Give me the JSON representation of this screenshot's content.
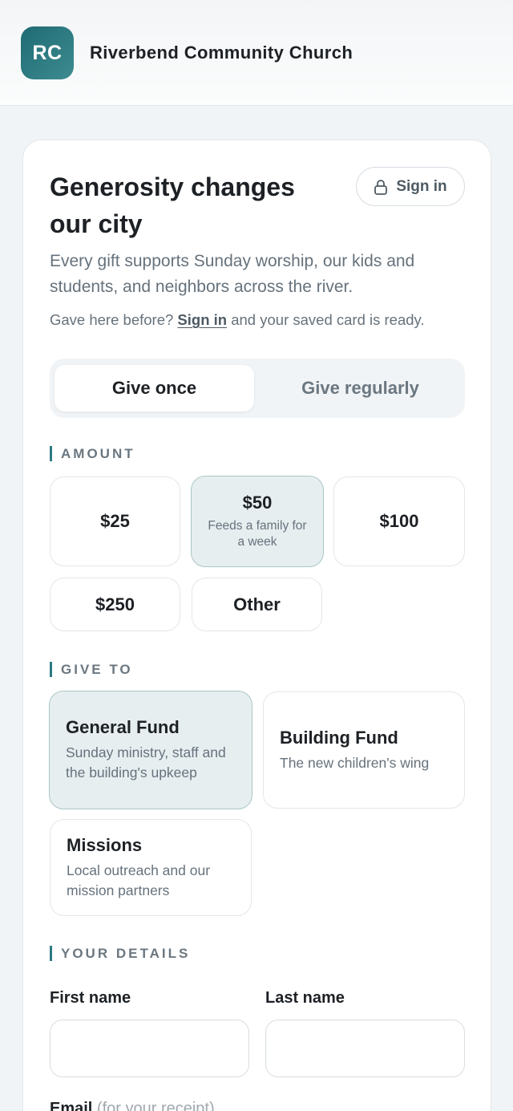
{
  "header": {
    "logo_initials": "RC",
    "church_name": "Riverbend Community Church"
  },
  "hero": {
    "headline": "Generosity changes our city",
    "signin_label": "Sign in",
    "intro": "Every gift supports Sunday worship, our kids and students, and neighbors across the river.",
    "return_prefix": "Gave here before?",
    "return_link": "Sign in",
    "return_suffix": "and your saved card is ready."
  },
  "frequency": {
    "options": [
      "Give once",
      "Give regularly"
    ],
    "selected": "Give once"
  },
  "amount": {
    "section_label": "AMOUNT",
    "options": [
      {
        "label": "$25",
        "note": ""
      },
      {
        "label": "$50",
        "note": "Feeds a family for a week"
      },
      {
        "label": "$100",
        "note": ""
      },
      {
        "label": "$250",
        "note": ""
      },
      {
        "label": "Other",
        "note": ""
      }
    ],
    "selected": "$50"
  },
  "give_to": {
    "section_label": "GIVE TO",
    "funds": [
      {
        "name": "General Fund",
        "description": "Sunday ministry, staff and the building's upkeep"
      },
      {
        "name": "Building Fund",
        "description": "The new children's wing"
      },
      {
        "name": "Missions",
        "description": "Local outreach and our mission partners"
      }
    ],
    "selected": "General Fund"
  },
  "details": {
    "section_label": "YOUR DETAILS",
    "first_name_label": "First name",
    "first_name_value": "",
    "last_name_label": "Last name",
    "last_name_value": "",
    "email_label": "Email",
    "email_hint": "(for your receipt)"
  },
  "colors": {
    "accent": "#2d7a80",
    "selected_bg": "#e7eef0",
    "selected_border": "#a9c7c5",
    "text_muted": "#66727c"
  }
}
